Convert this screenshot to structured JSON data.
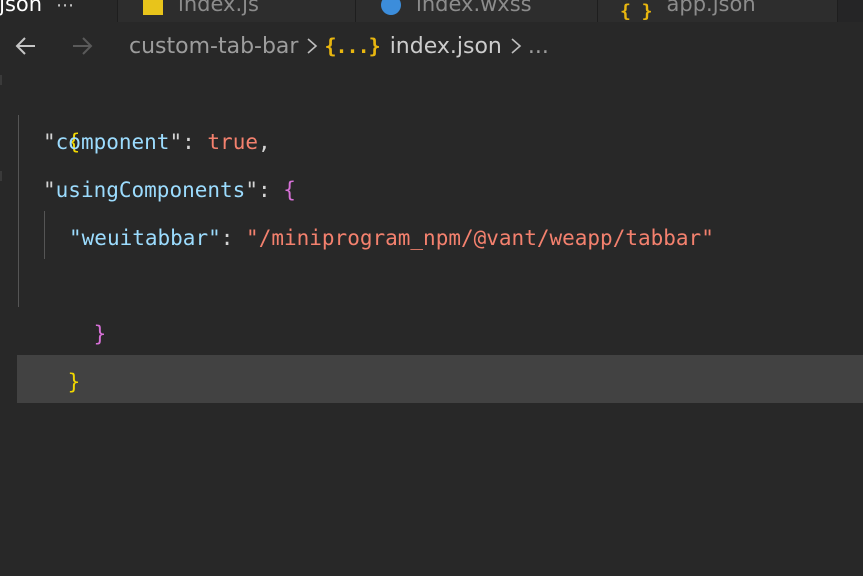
{
  "tabs": [
    {
      "label": "x.json",
      "icon": "json-icon",
      "active": true
    },
    {
      "label": "index.js",
      "icon": "js-icon",
      "active": false
    },
    {
      "label": "index.wxss",
      "icon": "wxss-icon",
      "active": false
    },
    {
      "label": "app.json",
      "icon": "json-icon",
      "active": false
    }
  ],
  "breadcrumb": {
    "folder": "custom-tab-bar",
    "file_icon": "{...}",
    "file": "index.json",
    "more": "..."
  },
  "code": {
    "line1": "{",
    "line2_key": "component",
    "line2_val": "true",
    "line3_key": "usingComponents",
    "line3_open": "{",
    "line4_key": "weuitabbar",
    "line4_val": "\"/miniprogram_npm/@vant/weapp/tabbar\"",
    "line5": "}",
    "line6": "}"
  },
  "colors": {
    "background": "#282828",
    "current_line": "#424242",
    "key": "#9cdcfe",
    "value": "#f4816e",
    "brace_outer": "#f1d700",
    "brace_inner": "#d670d6"
  }
}
